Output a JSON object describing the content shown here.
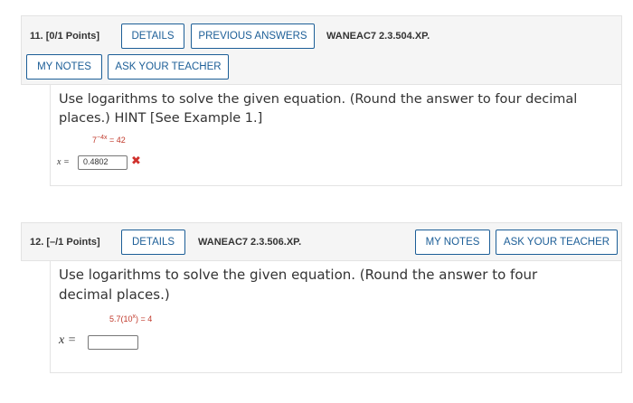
{
  "question11": {
    "number_label": "11. [0/1 Points]",
    "buttons": {
      "details": "DETAILS",
      "previous_answers": "PREVIOUS ANSWERS",
      "my_notes": "MY NOTES",
      "ask_teacher": "ASK YOUR TEACHER"
    },
    "code": "WANEAC7 2.3.504.XP.",
    "prompt_line1": "Use logarithms to solve the given equation. (Round the answer to four decimal",
    "prompt_line2": "places.) HINT [See Example 1.]",
    "equation_base": "7",
    "equation_exponent": "−4x",
    "equation_rhs": " = 42",
    "answer_label": "x =",
    "answer_value": "0.4802",
    "status_icon": "incorrect-x-icon",
    "status_color": "#d0312d"
  },
  "question12": {
    "number_label": "12. [–/1 Points]",
    "buttons": {
      "details": "DETAILS",
      "my_notes": "MY NOTES",
      "ask_teacher": "ASK YOUR TEACHER"
    },
    "code": "WANEAC7 2.3.506.XP.",
    "prompt_line1": "Use logarithms to solve the given equation. (Round the answer to four",
    "prompt_line2": "decimal places.)",
    "equation_pre": "5.7(10",
    "equation_exponent": "x",
    "equation_post": ") = 4",
    "answer_label": "x =",
    "answer_value": ""
  },
  "colors": {
    "accent": "#1c5e97",
    "equation": "#c0392b",
    "header_bg": "#f5f5f5"
  }
}
